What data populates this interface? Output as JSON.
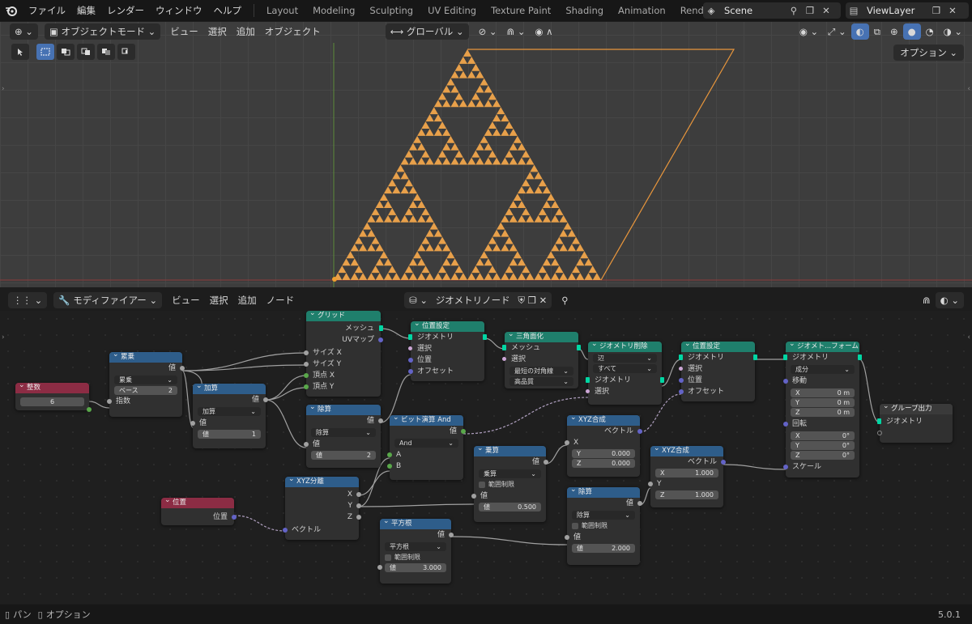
{
  "topbar": {
    "menus": [
      "ファイル",
      "編集",
      "レンダー",
      "ウィンドウ",
      "ヘルプ"
    ],
    "workspaces": [
      "Layout",
      "Modeling",
      "Sculpting",
      "UV Editing",
      "Texture Paint",
      "Shading",
      "Animation",
      "Rendering"
    ],
    "active_workspace": "Rendering",
    "scene": "Scene",
    "view_layer": "ViewLayer"
  },
  "viewport_header": {
    "mode": "オブジェクトモード",
    "menus": [
      "ビュー",
      "選択",
      "追加",
      "オブジェクト"
    ],
    "transform_orientation": "グローバル",
    "options": "オプション"
  },
  "node_header": {
    "editor_type": "モディファイアー",
    "menus": [
      "ビュー",
      "選択",
      "追加",
      "ノード"
    ],
    "tree_name": "ジオメトリノード"
  },
  "nodes": {
    "integer": {
      "title": "整数",
      "value": "6"
    },
    "power": {
      "title": "累乗",
      "out": "値",
      "mode": "累乗",
      "base_label": "ベース",
      "base_value": "2",
      "exp": "指数"
    },
    "grid": {
      "title": "グリッド",
      "mesh": "メッシュ",
      "uv": "UVマップ",
      "sx": "サイズ X",
      "sy": "サイズ Y",
      "vx": "頂点 X",
      "vy": "頂点 Y"
    },
    "add": {
      "title": "加算",
      "out": "値",
      "mode": "加算",
      "in": "値",
      "v_label": "値",
      "v_value": "1"
    },
    "divide1": {
      "title": "除算",
      "out": "値",
      "mode": "除算",
      "in": "値",
      "v_label": "値",
      "v_value": "2"
    },
    "setpos1": {
      "title": "位置設定",
      "geo": "ジオメトリ",
      "sel": "選択",
      "pos": "位置",
      "off": "オフセット"
    },
    "triangulate": {
      "title": "三角面化",
      "mesh": "メッシュ",
      "sel": "選択",
      "dd1": "最短の対角線",
      "dd2": "高品質"
    },
    "delete": {
      "title": "ジオメトリ削除",
      "dd1": "辺",
      "dd2": "すべて",
      "geo": "ジオメトリ",
      "sel": "選択"
    },
    "setpos2": {
      "title": "位置設定",
      "geo": "ジオメトリ",
      "sel": "選択",
      "pos": "位置",
      "off": "オフセット"
    },
    "transform": {
      "title": "ジオメト...フォーム",
      "geo": "ジオメトリ",
      "mode": "成分",
      "move": "移動",
      "mx": "0 m",
      "my": "0 m",
      "mz": "0 m",
      "rot": "回転",
      "rx": "0°",
      "ry": "0°",
      "rz": "0°",
      "scale": "スケール"
    },
    "output": {
      "title": "グループ出力",
      "geo": "ジオメトリ"
    },
    "bitand": {
      "title": "ビット演算 And",
      "out": "値",
      "mode": "And",
      "a": "A",
      "b": "B"
    },
    "combine1": {
      "title": "XYZ合成",
      "out": "ベクトル",
      "x": "X",
      "y_label": "Y",
      "y_value": "0.000",
      "z_label": "Z",
      "z_value": "0.000"
    },
    "multiply": {
      "title": "乗算",
      "out": "値",
      "mode": "乗算",
      "clamp": "範囲制限",
      "in": "値",
      "v_label": "値",
      "v_value": "0.500"
    },
    "combine2": {
      "title": "XYZ合成",
      "out": "ベクトル",
      "x_label": "X",
      "x_value": "1.000",
      "y": "Y",
      "z_label": "Z",
      "z_value": "1.000"
    },
    "divide2": {
      "title": "除算",
      "out": "値",
      "mode": "除算",
      "clamp": "範囲制限",
      "in": "値",
      "v_label": "値",
      "v_value": "2.000"
    },
    "position": {
      "title": "位置",
      "out": "位置"
    },
    "separate": {
      "title": "XYZ分離",
      "x": "X",
      "y": "Y",
      "z": "Z",
      "vec": "ベクトル"
    },
    "sqrt": {
      "title": "平方根",
      "out": "値",
      "mode": "平方根",
      "clamp": "範囲制限",
      "v_label": "値",
      "v_value": "3.000"
    }
  },
  "status": {
    "pan": "パン",
    "options": "オプション",
    "version": "5.0.1"
  },
  "colors": {
    "accent": "#4772b3",
    "mesh_orange": "#e8a04a",
    "geometry_socket": "#00d6a3"
  }
}
